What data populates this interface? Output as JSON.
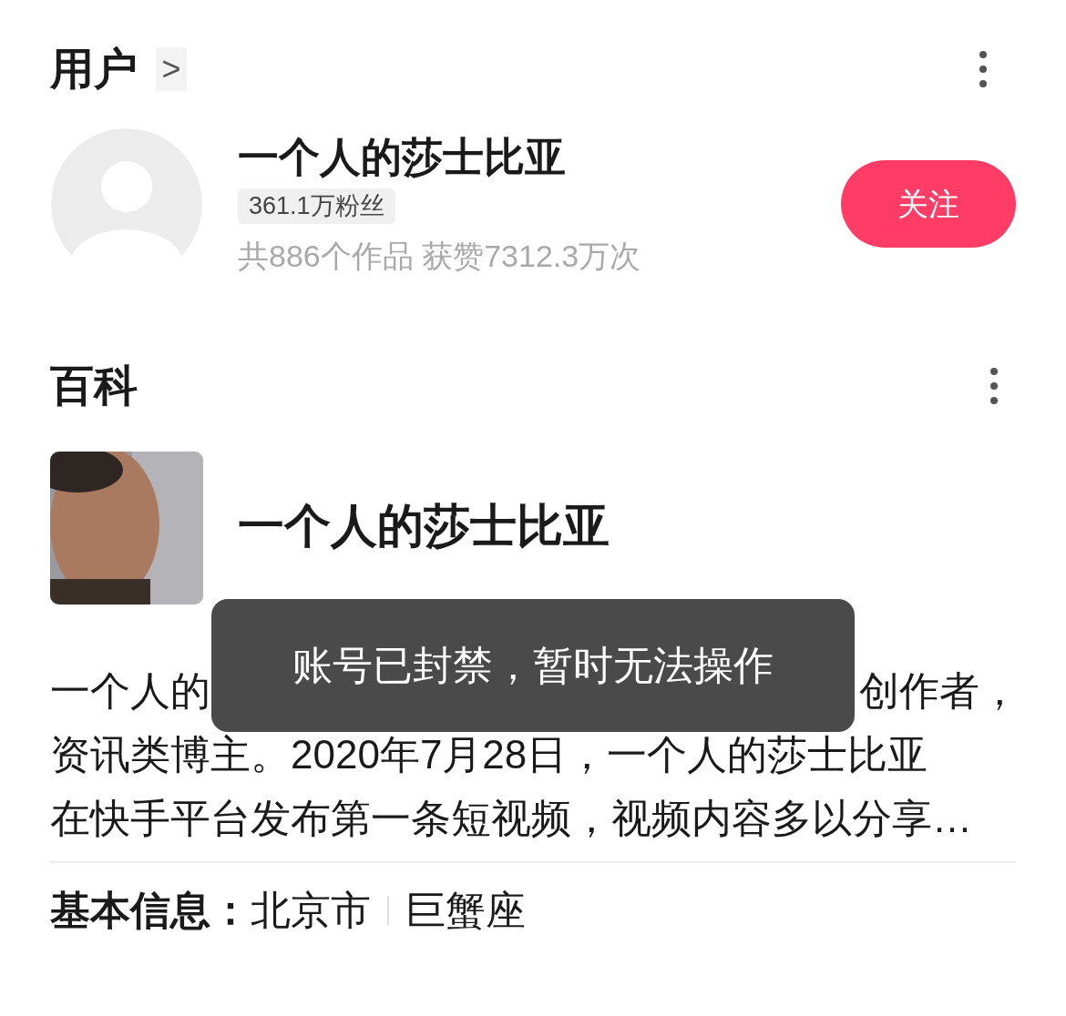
{
  "user_section": {
    "title": "用户",
    "arrow": ">",
    "user": {
      "name": "一个人的莎士比亚",
      "followers": "361.1万粉丝",
      "stats": "共886个作品 获赞7312.3万次"
    },
    "follow_button": "关注"
  },
  "baike_section": {
    "title": "百科",
    "entry_title": "一个人的莎士比亚",
    "summary_first_line_parts": [
      "一个人的",
      "创作者，"
    ],
    "summary_lines": [
      "资讯类博主。2020年7月28日，一个人的莎士比亚",
      "在快手平台发布第一条短视频，视频内容多以分享…"
    ],
    "basic_info": {
      "label": "基本信息：",
      "values": [
        "北京市",
        "巨蟹座"
      ]
    }
  },
  "toast": "账号已封禁，暂时无法操作"
}
